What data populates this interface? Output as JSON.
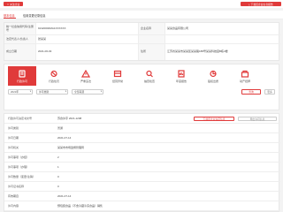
{
  "toolbar": {
    "favorite_label": "关注企业",
    "download_label": "下载该企业信息报告",
    "colors": {
      "accent": "#e03a3a"
    }
  },
  "tabs": [
    {
      "label": "基本信息",
      "active": true
    },
    {
      "label": "信用变更记录信息",
      "active": false
    }
  ],
  "info": {
    "rows": [
      {
        "l1": "统一社会信用代码/注册号",
        "v1": "91320000MA1XXXXXX",
        "l2": "企业名称",
        "v2": "某某食品有限公司"
      },
      {
        "l1": "法定代表人/负责人",
        "v1": "张某某",
        "l2": "",
        "v2": ""
      },
      {
        "l1": "成立日期",
        "v1": "2021-06-03",
        "l2": "住所",
        "v2": "江苏省某某市某某区某某路188号某某科技园B栋4楼"
      }
    ]
  },
  "nav": {
    "items": [
      {
        "label": "行政许可",
        "icon": "license-icon",
        "active": true
      },
      {
        "label": "行政处罚",
        "icon": "penalty-icon",
        "active": false
      },
      {
        "label": "严重违法",
        "icon": "warning-icon",
        "active": false
      },
      {
        "label": "经营异常",
        "icon": "abnormal-icon",
        "active": false
      },
      {
        "label": "抽查检查",
        "icon": "inspection-icon",
        "active": false
      },
      {
        "label": "年度报告",
        "icon": "report-icon",
        "active": false
      },
      {
        "label": "股权出质",
        "icon": "equity-icon",
        "active": false
      },
      {
        "label": "动产抵押",
        "icon": "mortgage-icon",
        "active": false
      },
      {
        "label": "知识产权",
        "icon": "ip-icon",
        "active": false
      },
      {
        "label": "司法协助",
        "icon": "judicial-icon",
        "active": false
      },
      {
        "label": "其他信息",
        "icon": "other-icon",
        "active": false
      },
      {
        "label": "更多",
        "icon": "more-icon",
        "active": false
      }
    ],
    "filters": {
      "year": "2021年",
      "type": "许可类别",
      "source": "全部来源",
      "search": "查询",
      "more": "更多"
    }
  },
  "detail": {
    "download_btn": "下载该企业许可信息",
    "export_btn": "导出许可信息",
    "rows": [
      {
        "label": "行政许可决定书文号",
        "value": "苏食许字 2021-1208"
      },
      {
        "label": "许可类别",
        "value": "普通"
      },
      {
        "label": "许可日期",
        "value": "2021-07-14"
      },
      {
        "label": "许可机关",
        "value": "某某市市场监督管理局"
      },
      {
        "label": "许可事项（办结）",
        "value": "2"
      },
      {
        "label": "许可事项（办理）",
        "value": "1"
      },
      {
        "label": "许可数量（变更/注销）",
        "value": "0"
      },
      {
        "label": "许可证书名称",
        "value": "0"
      },
      {
        "label": "有效期自",
        "value": "2021-07-14"
      },
      {
        "label": "许可内容",
        "value": "预包装食品（不含冷藏冷冻食品）销售"
      }
    ]
  }
}
